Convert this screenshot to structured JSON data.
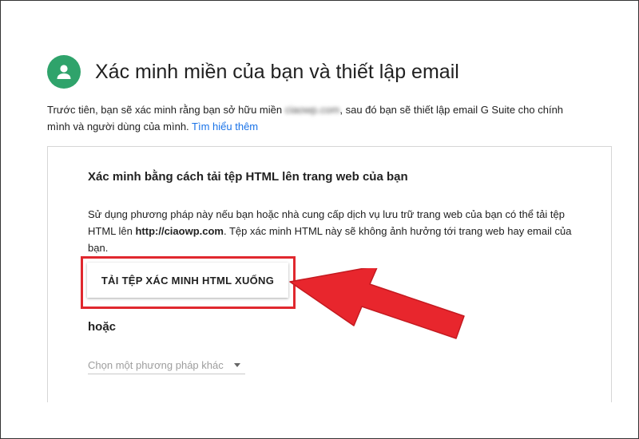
{
  "header": {
    "title": "Xác minh miền của bạn và thiết lập email"
  },
  "intro": {
    "text_before": "Trước tiên, bạn sẽ xác minh rằng bạn sở hữu miền ",
    "domain_blurred": "ciaowp.com",
    "text_after": ", sau đó bạn sẽ thiết lập email G Suite cho chính mình và người dùng của mình. ",
    "learn_more_link": "Tìm hiểu thêm"
  },
  "card": {
    "title": "Xác minh bằng cách tải tệp HTML lên trang web của bạn",
    "desc_before": "Sử dụng phương pháp này nếu bạn hoặc nhà cung cấp dịch vụ lưu trữ trang web của bạn có thể tải tệp HTML lên ",
    "desc_domain": "http://ciaowp.com",
    "desc_after": ". Tệp xác minh HTML này sẽ không ảnh hưởng tới trang web hay email của bạn.",
    "download_button_label": "TẢI TỆP XÁC MINH HTML XUỐNG",
    "or_label": "hoặc",
    "method_select_value": "Chọn một phương pháp khác"
  },
  "colors": {
    "avatar_bg": "#2fa36b",
    "link": "#1a73e8",
    "highlight": "#e0282e"
  },
  "icons": {
    "avatar": "person-icon",
    "dropdown": "caret-down-icon",
    "annotation": "red-arrow-icon"
  }
}
